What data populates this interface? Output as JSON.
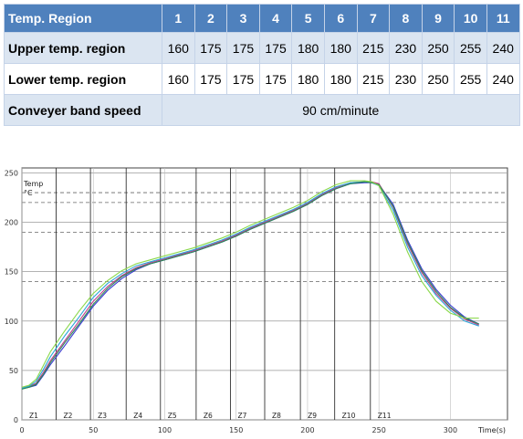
{
  "table": {
    "header_label": "Temp. Region",
    "regions": [
      "1",
      "2",
      "3",
      "4",
      "5",
      "6",
      "7",
      "8",
      "9",
      "10",
      "11"
    ],
    "rows": [
      {
        "label": "Upper temp. region",
        "values": [
          "160",
          "175",
          "175",
          "175",
          "180",
          "180",
          "215",
          "230",
          "250",
          "255",
          "240"
        ]
      },
      {
        "label": "Lower temp. region",
        "values": [
          "160",
          "175",
          "175",
          "175",
          "180",
          "180",
          "215",
          "230",
          "250",
          "255",
          "240"
        ]
      }
    ],
    "speed_label": "Conveyer band speed",
    "speed_value": "90 cm/minute"
  },
  "chart_data": {
    "type": "line",
    "ylabel": "Temp\n°C",
    "xlabel": "Time(s)",
    "xlim": [
      0,
      340
    ],
    "ylim": [
      0,
      255
    ],
    "x_ticks": [
      0,
      50,
      100,
      150,
      200,
      250,
      300
    ],
    "y_ticks": [
      0,
      50,
      100,
      150,
      200,
      250
    ],
    "zone_labels": [
      "Z1",
      "Z2",
      "Z3",
      "Z4",
      "Z5",
      "Z6",
      "Z7",
      "Z8",
      "Z9",
      "Z10",
      "Z11"
    ],
    "zone_boundaries": [
      0,
      24,
      48,
      73,
      97,
      122,
      146,
      170,
      195,
      219,
      244,
      340
    ],
    "dashed_levels": [
      230,
      220,
      190,
      140
    ],
    "grid": true,
    "colors": [
      "#3a3ad0",
      "#c03c8c",
      "#2aa6d8",
      "#2c8a54",
      "#8ad84a"
    ],
    "series": [
      {
        "x": [
          0,
          5,
          10,
          15,
          20,
          30,
          40,
          50,
          60,
          70,
          80,
          90,
          100,
          110,
          120,
          130,
          140,
          150,
          160,
          170,
          180,
          190,
          200,
          210,
          220,
          230,
          240,
          245,
          250,
          260,
          270,
          280,
          290,
          300,
          310,
          320
        ],
        "values": [
          32,
          33,
          35,
          45,
          56,
          75,
          95,
          115,
          131,
          143,
          152,
          158,
          162,
          166,
          170,
          175,
          180,
          186,
          193,
          199,
          205,
          211,
          218,
          227,
          234,
          239,
          240,
          240,
          238,
          218,
          182,
          153,
          132,
          116,
          104,
          97
        ]
      },
      {
        "x": [
          0,
          5,
          10,
          15,
          20,
          30,
          40,
          50,
          60,
          70,
          80,
          90,
          100,
          110,
          120,
          130,
          140,
          150,
          160,
          170,
          180,
          190,
          200,
          210,
          220,
          230,
          240,
          245,
          250,
          260,
          270,
          280,
          290,
          300,
          310,
          320
        ],
        "values": [
          33,
          34,
          37,
          48,
          60,
          80,
          100,
          120,
          135,
          146,
          154,
          159,
          163,
          167,
          171,
          176,
          181,
          187,
          194,
          200,
          206,
          212,
          219,
          228,
          235,
          240,
          241,
          241,
          239,
          215,
          178,
          149,
          128,
          113,
          102,
          96
        ]
      },
      {
        "x": [
          0,
          5,
          10,
          15,
          20,
          30,
          40,
          50,
          60,
          70,
          80,
          90,
          100,
          110,
          120,
          130,
          140,
          150,
          160,
          170,
          180,
          190,
          200,
          210,
          220,
          230,
          240,
          245,
          250,
          260,
          270,
          280,
          290,
          300,
          310,
          320
        ],
        "values": [
          32,
          34,
          39,
          51,
          64,
          85,
          104,
          124,
          138,
          148,
          156,
          160,
          164,
          168,
          172,
          177,
          182,
          188,
          195,
          201,
          207,
          213,
          220,
          229,
          236,
          240,
          241,
          240,
          237,
          212,
          175,
          146,
          126,
          111,
          100,
          95
        ]
      },
      {
        "x": [
          0,
          5,
          10,
          15,
          20,
          30,
          40,
          50,
          60,
          70,
          80,
          90,
          100,
          110,
          120,
          130,
          140,
          150,
          160,
          170,
          180,
          190,
          200,
          210,
          220,
          230,
          240,
          245,
          250,
          260,
          270,
          280,
          290,
          300,
          310,
          320
        ],
        "values": [
          31,
          33,
          36,
          46,
          58,
          78,
          97,
          117,
          133,
          145,
          153,
          158,
          162,
          166,
          170,
          175,
          180,
          186,
          193,
          199,
          205,
          211,
          218,
          227,
          234,
          239,
          241,
          240,
          238,
          216,
          180,
          151,
          130,
          114,
          103,
          97
        ]
      },
      {
        "x": [
          0,
          5,
          10,
          15,
          20,
          30,
          40,
          50,
          60,
          70,
          80,
          90,
          100,
          110,
          120,
          130,
          140,
          150,
          160,
          170,
          180,
          190,
          200,
          210,
          220,
          230,
          240,
          245,
          250,
          260,
          270,
          280,
          290,
          300,
          310,
          320
        ],
        "values": [
          33,
          35,
          41,
          55,
          69,
          90,
          110,
          128,
          141,
          151,
          158,
          162,
          166,
          170,
          174,
          179,
          184,
          190,
          197,
          203,
          209,
          215,
          222,
          231,
          238,
          242,
          242,
          241,
          237,
          208,
          170,
          140,
          120,
          108,
          103,
          103
        ]
      }
    ]
  }
}
